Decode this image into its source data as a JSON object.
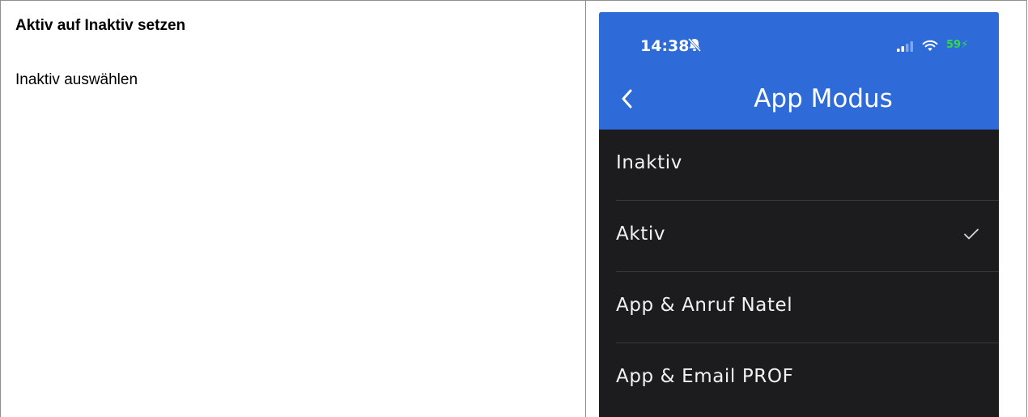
{
  "doc": {
    "heading": "Aktiv auf Inaktiv setzen",
    "instruction": "Inaktiv auswählen"
  },
  "phone": {
    "status": {
      "time": "14:38",
      "battery": "59"
    },
    "nav": {
      "title": "App Modus"
    },
    "options": [
      {
        "label": "Inaktiv",
        "selected": false
      },
      {
        "label": "Aktiv",
        "selected": true
      },
      {
        "label": "App & Anruf Natel",
        "selected": false
      },
      {
        "label": "App & Email PROF",
        "selected": false
      }
    ],
    "colors": {
      "navbar": "#2f6bd8",
      "list_bg": "#1c1c1e",
      "battery_green": "#32d74b"
    }
  }
}
